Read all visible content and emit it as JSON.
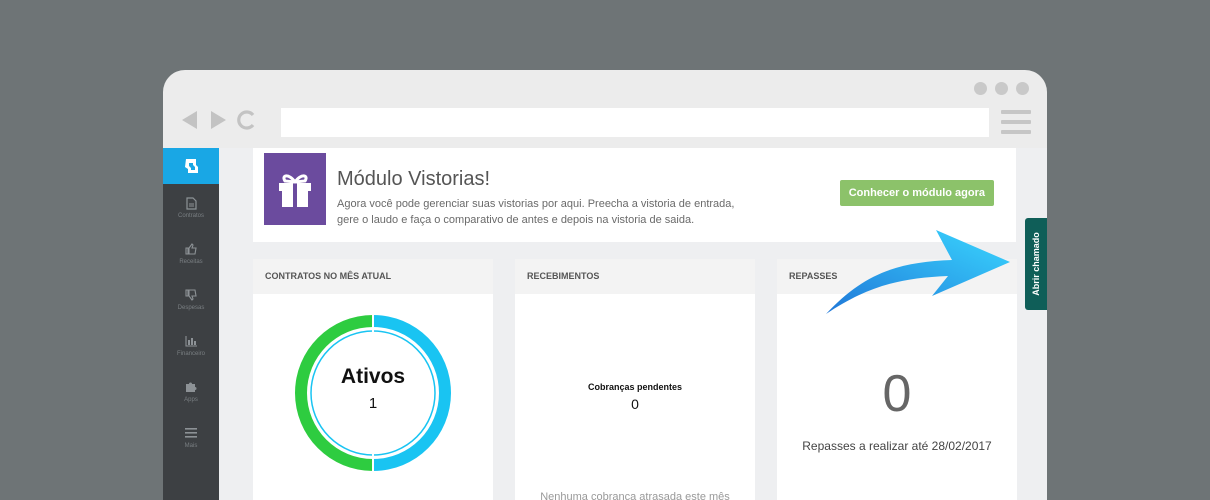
{
  "sidebar": {
    "items": [
      {
        "label": "Contratos",
        "icon": "document-icon"
      },
      {
        "label": "Receitas",
        "icon": "thumbs-up-icon"
      },
      {
        "label": "Despesas",
        "icon": "thumbs-down-icon"
      },
      {
        "label": "Financeiro",
        "icon": "bar-chart-icon"
      },
      {
        "label": "Apps",
        "icon": "puzzle-icon"
      },
      {
        "label": "Mais",
        "icon": "menu-icon"
      }
    ]
  },
  "banner": {
    "title": "Módulo Vistorias!",
    "text": "Agora você pode gerenciar suas vistorias por aqui. Preecha a vistoria de entrada, gere o laudo e faça o comparativo de antes e depois na vistoria de saida.",
    "cta": "Conhecer o módulo agora"
  },
  "cards": {
    "contratos": {
      "title": "CONTRATOS NO MÊS ATUAL",
      "donut_label": "Ativos",
      "donut_value": "1"
    },
    "recebimentos": {
      "title": "RECEBIMENTOS",
      "label": "Cobranças pendentes",
      "value": "0",
      "footer": "Nenhuma cobrança atrasada este mês"
    },
    "repasses": {
      "title": "REPASSES",
      "value": "0",
      "label": "Repasses a realizar até 28/02/2017"
    }
  },
  "ticket_tab": "Abrir chamado",
  "colors": {
    "brand": "#19a7e5",
    "cta": "#8cc26a",
    "donut_green": "#2ecc40",
    "donut_blue": "#19c4f2",
    "ticket": "#0f5e58",
    "gift": "#6b4b9e"
  }
}
